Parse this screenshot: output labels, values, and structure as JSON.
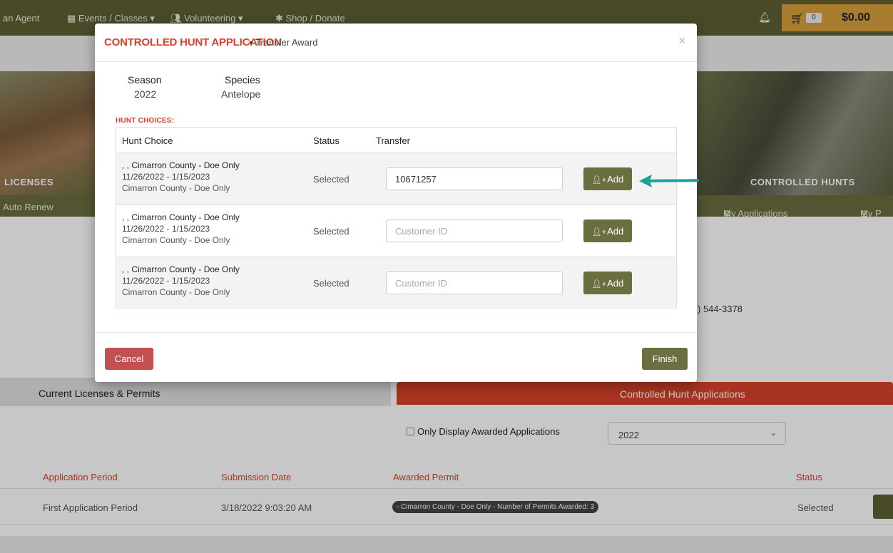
{
  "colors": {
    "brand_green": "#6b6e3f",
    "accent_red": "#d8422a",
    "cart_gold": "#d9a13d",
    "cancel_red": "#c25050",
    "arrow_teal": "#1aa394"
  },
  "topnav": {
    "agent": "an Agent",
    "events": "Events / Classes ▾",
    "volunteering": "Volunteering ▾",
    "shop": "Shop / Donate",
    "bell_icon": "bell-icon",
    "cart_count": "0",
    "cart_total": "$0.00"
  },
  "banner": {
    "left_label": "LICENSES",
    "right_label": "CONTROLLED HUNTS"
  },
  "greenbar": {
    "auto_renew": "Auto Renew",
    "my_applications": "My Applications",
    "my_p": "My P"
  },
  "page": {
    "phone_fragment": ") 544-3378",
    "tab_current": "Current Licenses & Permits",
    "tab_hunt": "Controlled Hunt Applications",
    "only_awarded": "Only Display Awarded Applications",
    "year_selected": "2022",
    "headers": {
      "period": "Application Period",
      "submission": "Submission Date",
      "awarded": "Awarded Permit",
      "status": "Status"
    },
    "row": {
      "period": "First Application Period",
      "submission": "3/18/2022 9:03:20 AM",
      "awarded": "- Cimarron County - Doe Only - Number of Permits Awarded: 3",
      "status": "Selected"
    }
  },
  "modal": {
    "title": "CONTROLLED HUNT APPLICATION",
    "separator": "•",
    "subtitle": "Transfer Award",
    "close": "×",
    "season_label": "Season",
    "season_value": "2022",
    "species_label": "Species",
    "species_value": "Antelope",
    "hunt_choices_label": "HUNT CHOICES:",
    "columns": {
      "hunt_choice": "Hunt Choice",
      "status": "Status",
      "transfer": "Transfer"
    },
    "rows": [
      {
        "line1": ", , Cimarron County - Doe Only",
        "line2": "11/26/2022 - 1/15/2023",
        "line3": "Cimarron County - Doe Only",
        "status": "Selected",
        "customer_id": "10671257",
        "placeholder": "Customer ID",
        "add_label": "Add"
      },
      {
        "line1": ", , Cimarron County - Doe Only",
        "line2": "11/26/2022 - 1/15/2023",
        "line3": "Cimarron County - Doe Only",
        "status": "Selected",
        "customer_id": "",
        "placeholder": "Customer ID",
        "add_label": "Add"
      },
      {
        "line1": ", , Cimarron County - Doe Only",
        "line2": "11/26/2022 - 1/15/2023",
        "line3": "Cimarron County - Doe Only",
        "status": "Selected",
        "customer_id": "",
        "placeholder": "Customer ID",
        "add_label": "Add"
      }
    ],
    "cancel_label": "Cancel",
    "finish_label": "Finish"
  }
}
